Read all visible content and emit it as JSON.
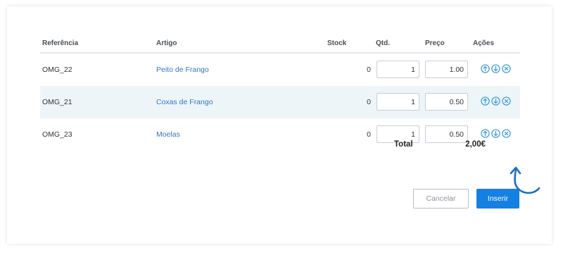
{
  "table": {
    "headers": {
      "ref": "Referência",
      "article": "Artigo",
      "stock": "Stock",
      "qty": "Qtd.",
      "price": "Preço",
      "actions": "Ações"
    },
    "rows": [
      {
        "ref": "OMG_22",
        "article": "Peito de Frango",
        "stock": "0",
        "qty": "1",
        "price": "1.00"
      },
      {
        "ref": "OMG_21",
        "article": "Coxas de Frango",
        "stock": "0",
        "qty": "1",
        "price": "0.50"
      },
      {
        "ref": "OMG_23",
        "article": "Moelas",
        "stock": "0",
        "qty": "1",
        "price": "0.50"
      }
    ]
  },
  "summary": {
    "total_label": "Total",
    "total_value": "2,00€"
  },
  "buttons": {
    "cancel": "Cancelar",
    "insert": "Inserir"
  },
  "icons": {
    "move_up": "arrow-up-circle-icon",
    "move_down": "arrow-down-circle-icon",
    "remove": "close-circle-icon",
    "annotation": "curved-arrow-icon"
  },
  "colors": {
    "accent": "#1580e3",
    "link": "#2f77c6",
    "row_highlight": "#eef5f9",
    "action_icon": "#3a9bd8"
  }
}
